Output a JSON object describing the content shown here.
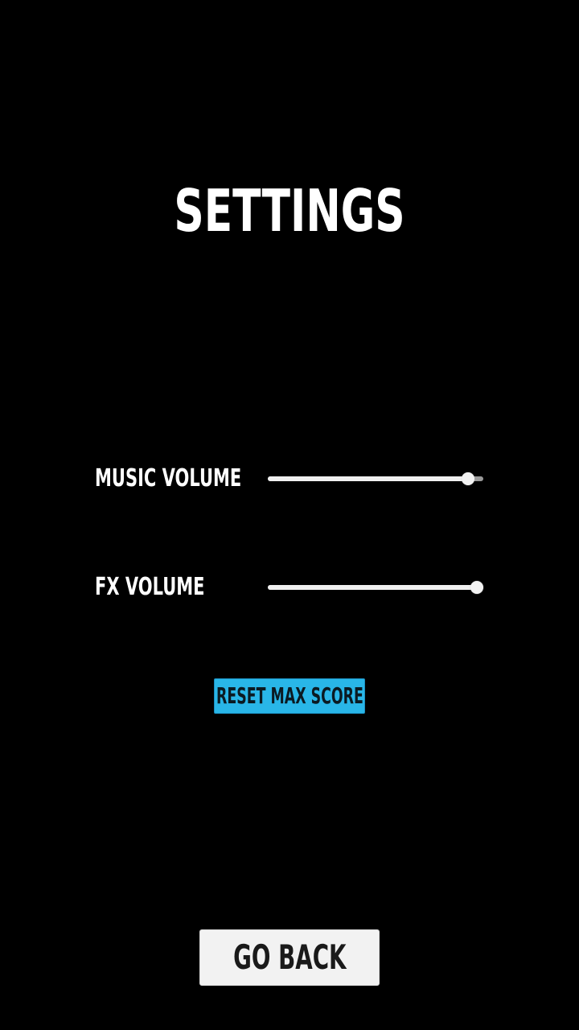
{
  "screen": {
    "title": "SETTINGS"
  },
  "settings": {
    "music": {
      "label": "MUSIC VOLUME",
      "value_fraction": 0.93
    },
    "fx": {
      "label": "FX VOLUME",
      "value_fraction": 0.97
    }
  },
  "actions": {
    "reset_label": "RESET MAX SCORE",
    "back_label": "GO BACK"
  },
  "colors": {
    "background": "#000000",
    "accent": "#29b6e8",
    "text": "#ffffff",
    "back_button": "#f2f2f2"
  }
}
